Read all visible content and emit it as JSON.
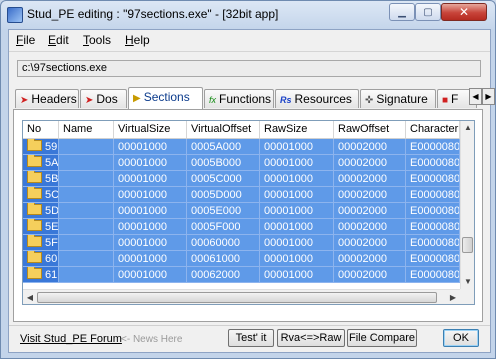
{
  "window": {
    "title": "Stud_PE editing : \"97sections.exe\" - [32bit app]",
    "controls": {
      "minimize": "▁",
      "maximize": "▢",
      "close": "✕"
    }
  },
  "menu": [
    "File",
    "Edit",
    "Tools",
    "Help"
  ],
  "file_path": "c:\\97sections.exe",
  "tabs": [
    {
      "label": "Headers",
      "icon": "red-flag-icon",
      "glyph": "➤"
    },
    {
      "label": "Dos",
      "icon": "red-flag-icon",
      "glyph": "➤"
    },
    {
      "label": "Sections",
      "icon": "yellow-flag-icon",
      "glyph": "▶",
      "active": true
    },
    {
      "label": "Functions",
      "icon": "fx-icon",
      "glyph": "fx"
    },
    {
      "label": "Resources",
      "icon": "rs-icon",
      "glyph": "Rs"
    },
    {
      "label": "Signature",
      "icon": "pin-icon",
      "glyph": "✜"
    },
    {
      "label": "F",
      "icon": "flag-icon",
      "glyph": "■"
    }
  ],
  "tab_scroll": {
    "left": "◀",
    "right": "▶"
  },
  "table": {
    "columns": [
      "No",
      "Name",
      "VirtualSize",
      "VirtualOffset",
      "RawSize",
      "RawOffset",
      "Characteri..."
    ],
    "rows": [
      [
        "59",
        "",
        "00001000",
        "0005A000",
        "00001000",
        "00002000",
        "E0000080"
      ],
      [
        "5A",
        "",
        "00001000",
        "0005B000",
        "00001000",
        "00002000",
        "E0000080"
      ],
      [
        "5B",
        "",
        "00001000",
        "0005C000",
        "00001000",
        "00002000",
        "E0000080"
      ],
      [
        "5C",
        "",
        "00001000",
        "0005D000",
        "00001000",
        "00002000",
        "E0000080"
      ],
      [
        "5D",
        "",
        "00001000",
        "0005E000",
        "00001000",
        "00002000",
        "E0000080"
      ],
      [
        "5E",
        "",
        "00001000",
        "0005F000",
        "00001000",
        "00002000",
        "E0000080"
      ],
      [
        "5F",
        "",
        "00001000",
        "00060000",
        "00001000",
        "00002000",
        "E0000080"
      ],
      [
        "60",
        "",
        "00001000",
        "00061000",
        "00001000",
        "00002000",
        "E0000080"
      ],
      [
        "61",
        "",
        "00001000",
        "00062000",
        "00001000",
        "00002000",
        "E0000080"
      ]
    ],
    "scroll": {
      "up": "▲",
      "down": "▼",
      "left": "◀",
      "right": "▶"
    }
  },
  "footer": {
    "forum_link": "Visit Stud_PE Forum",
    "news_link": "<- News Here",
    "buttons": {
      "test": "Test' it",
      "rva": "Rva<=>Raw",
      "compare": "File Compare",
      "ok": "OK"
    }
  },
  "colors": {
    "selection": "#5f9ae8",
    "accent": "#3a78d8"
  }
}
